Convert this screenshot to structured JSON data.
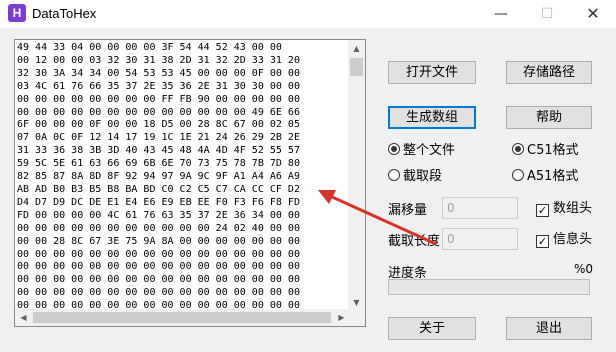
{
  "window": {
    "title": "DataToHex",
    "app_icon_letter": "H",
    "minimize": "—",
    "maximize": "☐",
    "close": "✕"
  },
  "hex_rows": [
    "49 44 33 04 00 00 00 00 3F 54 44 52 43 00 00",
    "00 12 00 00 03 32 30 31 38 2D 31 32 2D 33 31 20",
    "32 30 3A 34 34 00 54 53 53 45 00 00 00 0F 00 00",
    "03 4C 61 76 66 35 37 2E 35 36 2E 31 30 30 00 00",
    "00 00 00 00 00 00 00 00 FF FB 90 00 00 00 00 00",
    "00 00 00 00 00 00 00 00 00 00 00 00 00 49 6E 66",
    "6F 00 00 00 0F 00 00 18 D5 00 28 8C 67 00 02 05",
    "07 0A 0C 0F 12 14 17 19 1C 1E 21 24 26 29 2B 2E",
    "31 33 36 38 3B 3D 40 43 45 48 4A 4D 4F 52 55 57",
    "59 5C 5E 61 63 66 69 6B 6E 70 73 75 78 7B 7D 80",
    "82 85 87 8A 8D 8F 92 94 97 9A 9C 9F A1 A4 A6 A9",
    "AB AD B0 B3 B5 B8 BA BD C0 C2 C5 C7 CA CC CF D2",
    "D4 D7 D9 DC DE E1 E4 E6 E9 EB EE F0 F3 F6 F8 FD",
    "FD 00 00 00 00 4C 61 76 63 35 37 2E 36 34 00 00",
    "00 00 00 00 00 00 00 00 00 00 00 24 02 40 00 00",
    "00 00 28 8C 67 3E 75 9A 8A 00 00 00 00 00 00 00",
    "00 00 00 00 00 00 00 00 00 00 00 00 00 00 00 00",
    "00 00 00 00 00 00 00 00 00 00 00 00 00 00 00 00",
    "00 00 00 00 00 00 00 00 00 00 00 00 00 00 00 00",
    "00 00 00 00 00 00 00 00 00 00 00 00 00 00 00 00",
    "00 00 00 00 00 00 00 00 00 00 00 00 00 00 00 00"
  ],
  "buttons": {
    "open_file": "打开文件",
    "save_path": "存储路径",
    "generate_array": "生成数组",
    "help": "帮助",
    "about": "关于",
    "exit": "退出"
  },
  "scope": {
    "whole_file": {
      "label": "整个文件",
      "checked": true
    },
    "segment": {
      "label": "截取段",
      "checked": false
    }
  },
  "format": {
    "c51": {
      "label": "C51格式",
      "checked": true
    },
    "a51": {
      "label": "A51格式",
      "checked": false
    }
  },
  "offset": {
    "label": "漏移量",
    "value": "0"
  },
  "length": {
    "label": "截取长度",
    "value": "0"
  },
  "options": {
    "array_header": {
      "label": "数组头",
      "checked": true
    },
    "info_header": {
      "label": "信息头",
      "checked": true
    }
  },
  "progress": {
    "label": "进度条",
    "percent_text": "%0",
    "value": 0
  },
  "colors": {
    "accent": "#0078d7",
    "app_icon": "#7b3fd0",
    "annotation_arrow": "#d9342b"
  }
}
